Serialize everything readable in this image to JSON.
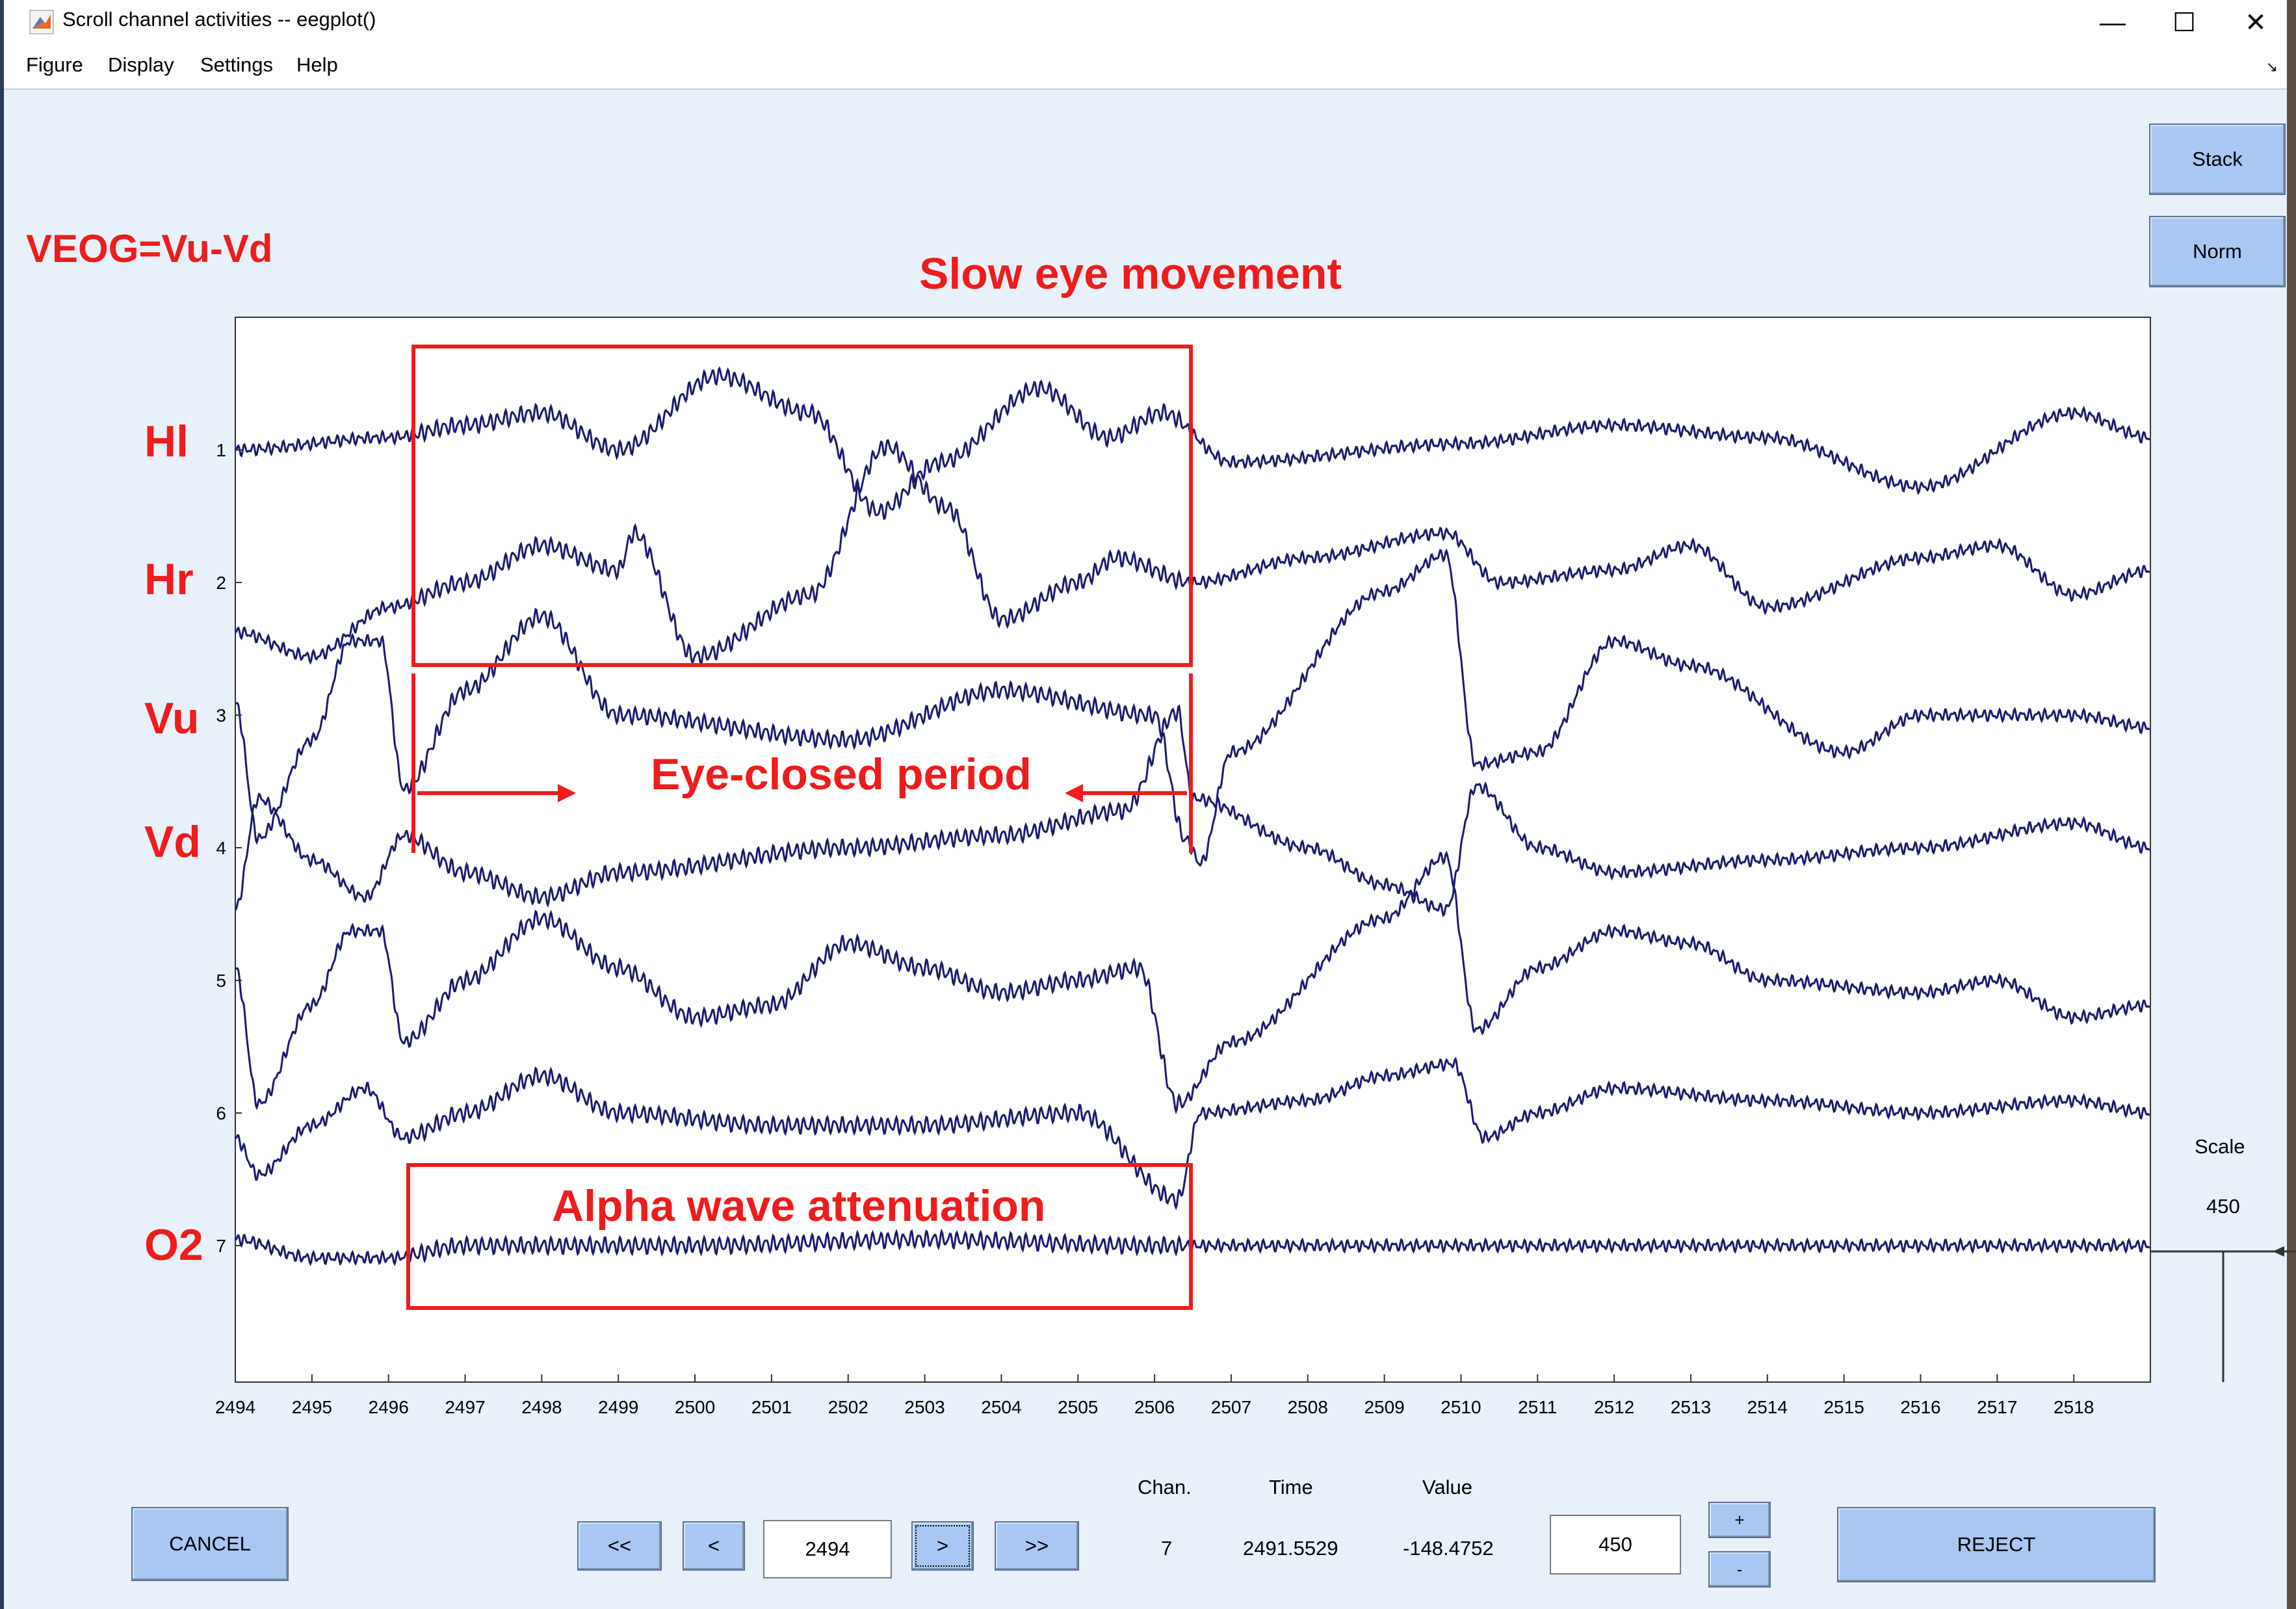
{
  "window": {
    "title": "Scroll channel activities -- eegplot()",
    "controls": {
      "minimize": "—",
      "maximize": "☐",
      "close": "✕"
    }
  },
  "menu": [
    "Figure",
    "Display",
    "Settings",
    "Help"
  ],
  "side_buttons": {
    "stack": "Stack",
    "norm": "Norm"
  },
  "scale": {
    "label": "Scale",
    "value": "450"
  },
  "annotations": {
    "veog": "VEOG=Vu-Vd",
    "slow_eye": "Slow eye movement",
    "eye_closed": "Eye-closed period",
    "alpha": "Alpha wave attenuation",
    "channel_names": [
      "Hl",
      "Hr",
      "Vu",
      "Vd",
      "O2"
    ]
  },
  "channel_numbers": [
    "1",
    "2",
    "3",
    "4",
    "5",
    "6",
    "7"
  ],
  "x_ticks": [
    "2494",
    "2495",
    "2496",
    "2497",
    "2498",
    "2499",
    "2500",
    "2501",
    "2502",
    "2503",
    "2504",
    "2505",
    "2506",
    "2507",
    "2508",
    "2509",
    "2510",
    "2511",
    "2512",
    "2513",
    "2514",
    "2515",
    "2516",
    "2517",
    "2518"
  ],
  "bottom": {
    "cancel": "CANCEL",
    "first": "<<",
    "prev": "<",
    "time_input": "2494",
    "next": ">",
    "last": ">>",
    "readout_headers": {
      "chan": "Chan.",
      "time": "Time",
      "value": "Value"
    },
    "readout": {
      "chan": "7",
      "time": "2491.5529",
      "value": "-148.4752"
    },
    "scale_input": "450",
    "plus": "+",
    "minus": "-",
    "reject": "REJECT"
  },
  "colors": {
    "trace": "#1a1a6e",
    "annotation": "#ee1c1c",
    "button": "#a8c7f2",
    "background": "#e8f1fa"
  },
  "chart_data": {
    "type": "line",
    "x_range": [
      2494,
      2519
    ],
    "series": [
      {
        "channel": "1",
        "anchors": [
          [
            2494,
            0
          ],
          [
            2496,
            0.1
          ],
          [
            2497,
            0.2
          ],
          [
            2498,
            0.3
          ],
          [
            2499,
            0.0
          ],
          [
            2500.3,
            0.6
          ],
          [
            2501.5,
            0.3
          ],
          [
            2502.4,
            -0.5
          ],
          [
            2503.2,
            -0.1
          ],
          [
            2504.5,
            0.5
          ],
          [
            2505.4,
            0.1
          ],
          [
            2506.1,
            0.3
          ],
          [
            2507,
            -0.1
          ],
          [
            2510,
            0.05
          ],
          [
            2512,
            0.2
          ],
          [
            2514,
            0.1
          ],
          [
            2516,
            -0.3
          ],
          [
            2518,
            0.3
          ],
          [
            2519,
            0.1
          ]
        ]
      },
      {
        "channel": "2",
        "anchors": [
          [
            2494,
            -0.4
          ],
          [
            2495,
            -0.6
          ],
          [
            2496,
            -0.2
          ],
          [
            2497,
            0.0
          ],
          [
            2498,
            0.3
          ],
          [
            2499,
            0.1
          ],
          [
            2499.2,
            0.4
          ],
          [
            2500,
            -0.6
          ],
          [
            2501.5,
            -0.1
          ],
          [
            2502.5,
            1.1
          ],
          [
            2503.3,
            0.6
          ],
          [
            2504,
            -0.3
          ],
          [
            2505,
            0.0
          ],
          [
            2505.5,
            0.2
          ],
          [
            2506.5,
            0.0
          ],
          [
            2508,
            0.2
          ],
          [
            2509.8,
            0.4
          ],
          [
            2510.5,
            0.0
          ],
          [
            2512,
            0.1
          ],
          [
            2513,
            0.3
          ],
          [
            2514,
            -0.2
          ],
          [
            2516,
            0.2
          ],
          [
            2517,
            0.3
          ],
          [
            2518,
            -0.1
          ],
          [
            2519,
            0.1
          ]
        ]
      },
      {
        "channel": "3",
        "anchors": [
          [
            2494,
            0.1
          ],
          [
            2494.3,
            -1.0
          ],
          [
            2495,
            -0.2
          ],
          [
            2495.5,
            0.6
          ],
          [
            2495.9,
            0.6
          ],
          [
            2496.2,
            -0.6
          ],
          [
            2497,
            0.2
          ],
          [
            2498,
            0.8
          ],
          [
            2499,
            0.0
          ],
          [
            2502,
            -0.2
          ],
          [
            2504,
            0.2
          ],
          [
            2506,
            0.0
          ],
          [
            2506.4,
            -1.0
          ],
          [
            2506.6,
            -1.2
          ],
          [
            2507,
            -0.3
          ],
          [
            2509,
            1.0
          ],
          [
            2509.8,
            1.3
          ],
          [
            2510.2,
            -0.4
          ],
          [
            2511,
            -0.3
          ],
          [
            2512,
            0.6
          ],
          [
            2513,
            0.4
          ],
          [
            2515,
            -0.3
          ],
          [
            2516,
            0.0
          ],
          [
            2518,
            0.0
          ],
          [
            2519,
            -0.1
          ]
        ]
      },
      {
        "channel": "4",
        "anchors": [
          [
            2494,
            -0.5
          ],
          [
            2494.3,
            0.4
          ],
          [
            2495,
            -0.1
          ],
          [
            2495.7,
            -0.4
          ],
          [
            2496.2,
            0.1
          ],
          [
            2497,
            -0.2
          ],
          [
            2498,
            -0.4
          ],
          [
            2499,
            -0.2
          ],
          [
            2502,
            0.0
          ],
          [
            2504,
            0.1
          ],
          [
            2505.6,
            0.3
          ],
          [
            2506.3,
            1.1
          ],
          [
            2506.5,
            0.4
          ],
          [
            2508,
            0.0
          ],
          [
            2509,
            -0.3
          ],
          [
            2509.8,
            -0.5
          ],
          [
            2510.2,
            0.5
          ],
          [
            2511,
            0.0
          ],
          [
            2512,
            -0.2
          ],
          [
            2514,
            -0.1
          ],
          [
            2516,
            0.0
          ],
          [
            2518,
            0.2
          ],
          [
            2519,
            0.0
          ]
        ]
      },
      {
        "channel": "5",
        "anchors": [
          [
            2494,
            0.1
          ],
          [
            2494.3,
            -1.0
          ],
          [
            2495,
            -0.2
          ],
          [
            2495.5,
            0.4
          ],
          [
            2495.9,
            0.4
          ],
          [
            2496.2,
            -0.5
          ],
          [
            2497,
            0.0
          ],
          [
            2498,
            0.5
          ],
          [
            2499,
            0.1
          ],
          [
            2500,
            -0.3
          ],
          [
            2501,
            -0.2
          ],
          [
            2502,
            0.3
          ],
          [
            2503,
            0.1
          ],
          [
            2504,
            -0.1
          ],
          [
            2505,
            0.0
          ],
          [
            2505.8,
            0.1
          ],
          [
            2506.3,
            -1.0
          ],
          [
            2507,
            -0.5
          ],
          [
            2509,
            0.5
          ],
          [
            2509.8,
            1.0
          ],
          [
            2510.2,
            -0.4
          ],
          [
            2511,
            0.1
          ],
          [
            2512,
            0.4
          ],
          [
            2513,
            0.3
          ],
          [
            2514,
            0.0
          ],
          [
            2516,
            -0.1
          ],
          [
            2517,
            0.0
          ],
          [
            2518,
            -0.3
          ],
          [
            2519,
            -0.2
          ]
        ]
      },
      {
        "channel": "6",
        "anchors": [
          [
            2494,
            -0.2
          ],
          [
            2494.3,
            -0.5
          ],
          [
            2495,
            -0.1
          ],
          [
            2495.7,
            0.2
          ],
          [
            2496.2,
            -0.2
          ],
          [
            2497,
            0.0
          ],
          [
            2498,
            0.3
          ],
          [
            2499,
            0.0
          ],
          [
            2501,
            -0.1
          ],
          [
            2503,
            -0.1
          ],
          [
            2505,
            0.0
          ],
          [
            2506.3,
            -0.7
          ],
          [
            2506.6,
            0.0
          ],
          [
            2508,
            0.1
          ],
          [
            2509,
            0.3
          ],
          [
            2509.9,
            0.4
          ],
          [
            2510.3,
            -0.2
          ],
          [
            2511,
            0.0
          ],
          [
            2512,
            0.2
          ],
          [
            2514,
            0.1
          ],
          [
            2516,
            0.0
          ],
          [
            2518,
            0.1
          ],
          [
            2519,
            0.0
          ]
        ]
      },
      {
        "channel": "7",
        "anchors": [
          [
            2494,
            0.05
          ],
          [
            2495,
            -0.1
          ],
          [
            2496,
            -0.1
          ],
          [
            2497,
            0.0
          ],
          [
            2500,
            0.0
          ],
          [
            2503,
            0.05
          ],
          [
            2506,
            0.0
          ],
          [
            2509,
            0.0
          ],
          [
            2512,
            0.0
          ],
          [
            2515,
            0.0
          ],
          [
            2518,
            0.0
          ],
          [
            2519,
            0.0
          ]
        ]
      }
    ]
  }
}
